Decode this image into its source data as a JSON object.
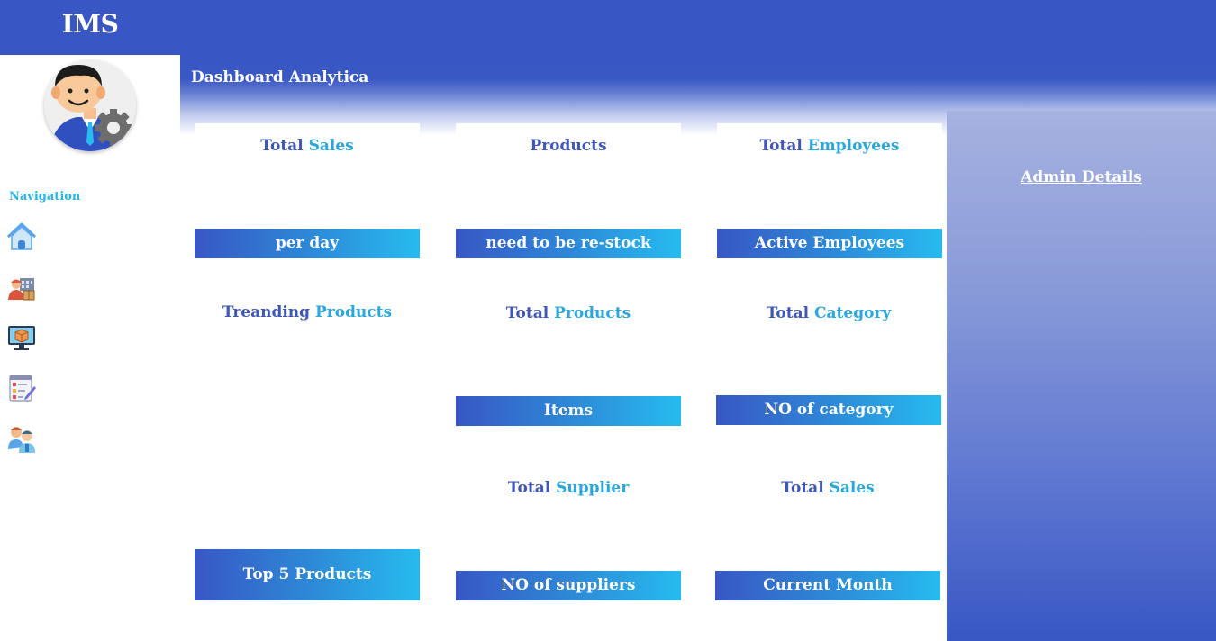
{
  "app": {
    "brand": "IMS"
  },
  "header": {
    "title": "Dashboard Analytica"
  },
  "sidebar": {
    "nav_label": "Navigation",
    "items": [
      {
        "icon": "home-icon"
      },
      {
        "icon": "warehouse-worker-icon"
      },
      {
        "icon": "product-monitor-icon"
      },
      {
        "icon": "checklist-icon"
      },
      {
        "icon": "users-icon"
      }
    ]
  },
  "cards": {
    "total_sales": {
      "w1": "Total",
      "w2": "Sales",
      "bar": "per day"
    },
    "products": {
      "w1": "Products",
      "w2": "",
      "bar": "need to be re-stock"
    },
    "total_employees": {
      "w1": "Total",
      "w2": "Employees",
      "bar": "Active Employees"
    },
    "trending_products": {
      "w1": "Treanding",
      "w2": "Products",
      "bar": "Top 5 Products"
    },
    "total_products": {
      "w1": "Total",
      "w2": "Products",
      "bar": "Items"
    },
    "total_category": {
      "w1": "Total",
      "w2": "Category",
      "bar": "NO of category"
    },
    "total_supplier": {
      "w1": "Total",
      "w2": "Supplier",
      "bar": "NO of suppliers"
    },
    "total_sales_month": {
      "w1": "Total",
      "w2": "Sales",
      "bar": "Current  Month"
    }
  },
  "admin": {
    "title": "Admin Details"
  },
  "colors": {
    "primary": "#3857c4",
    "accent": "#27bbef",
    "heading_dark": "#3e57b8",
    "heading_light": "#2aa7df"
  }
}
